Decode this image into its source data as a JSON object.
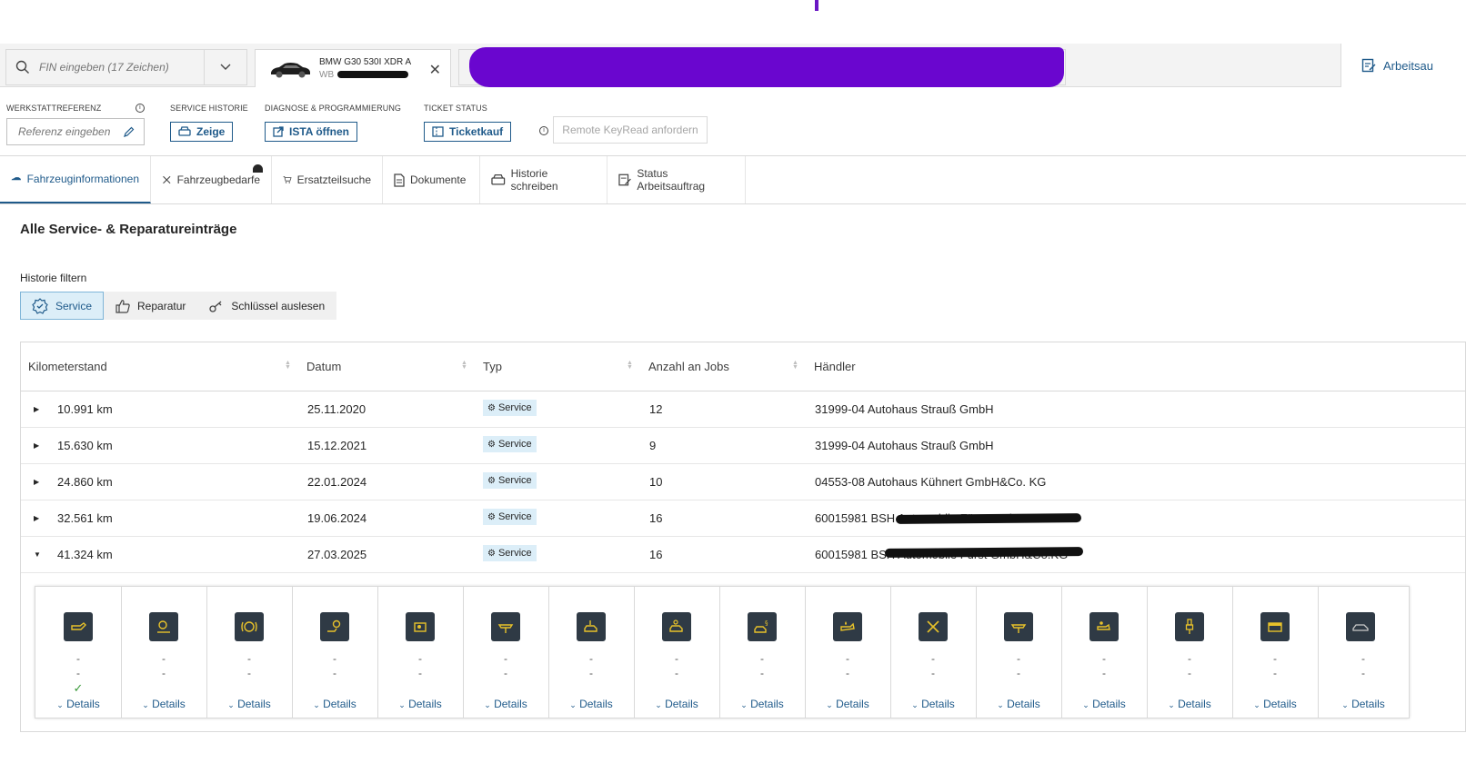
{
  "topbar": {
    "vin_placeholder": "FIN eingeben (17 Zeichen)",
    "vehicle_model": "BMW G30 530I XDR A",
    "vehicle_vin_prefix": "WB",
    "arbeits_label": "Arbeitsau"
  },
  "meta": {
    "werkstatt_label": "WERKSTATTREFERENZ",
    "werkstatt_placeholder": "Referenz eingeben",
    "service_label": "SERVICE HISTORIE",
    "service_btn": "Zeige",
    "diag_label": "DIAGNOSE & PROGRAMMIERUNG",
    "diag_btn": "ISTA öffnen",
    "ticket_label": "TICKET STATUS",
    "ticket_btn": "Ticketkauf",
    "remote_btn": "Remote KeyRead anfordern"
  },
  "tabs": [
    {
      "label": "Fahrzeuginformationen"
    },
    {
      "label": "Fahrzeugbedarfe"
    },
    {
      "label": "Ersatzteilsuche"
    },
    {
      "label": "Dokumente"
    },
    {
      "label": "Historie schreiben"
    },
    {
      "label": "Status Arbeitsauftrag"
    }
  ],
  "main": {
    "title": "Alle Service- & Reparatureinträge",
    "filter_label": "Historie filtern",
    "filters": [
      "Service",
      "Reparatur",
      "Schlüssel auslesen"
    ]
  },
  "table": {
    "columns": [
      "Kilometerstand",
      "Datum",
      "Typ",
      "Anzahl an Jobs",
      "Händler"
    ],
    "rows": [
      {
        "km": "10.991 km",
        "date": "25.11.2020",
        "type": "Service",
        "jobs": "12",
        "dealer": "31999-04 Autohaus Strauß GmbH"
      },
      {
        "km": "15.630 km",
        "date": "15.12.2021",
        "type": "Service",
        "jobs": "9",
        "dealer": "31999-04 Autohaus Strauß GmbH"
      },
      {
        "km": "24.860 km",
        "date": "22.01.2024",
        "type": "Service",
        "jobs": "10",
        "dealer": "04553-08 Autohaus Kühnert GmbH&Co. KG"
      },
      {
        "km": "32.561 km",
        "date": "19.06.2024",
        "type": "Service",
        "jobs": "16",
        "dealer": "60015981 BSH Automobile Fürst GmbH&Co.KG"
      },
      {
        "km": "41.324 km",
        "date": "27.03.2025",
        "type": "Service",
        "jobs": "16",
        "dealer": "60015981 BSH Automobile Fürst GmbH&Co.KG"
      }
    ],
    "dash": "-",
    "details_label": "Details",
    "check_mark": "✓"
  },
  "colors": {
    "accent": "#1f5a8a",
    "type_badge_bg": "#dceef8",
    "job_icon_bg": "#2f3a45"
  }
}
